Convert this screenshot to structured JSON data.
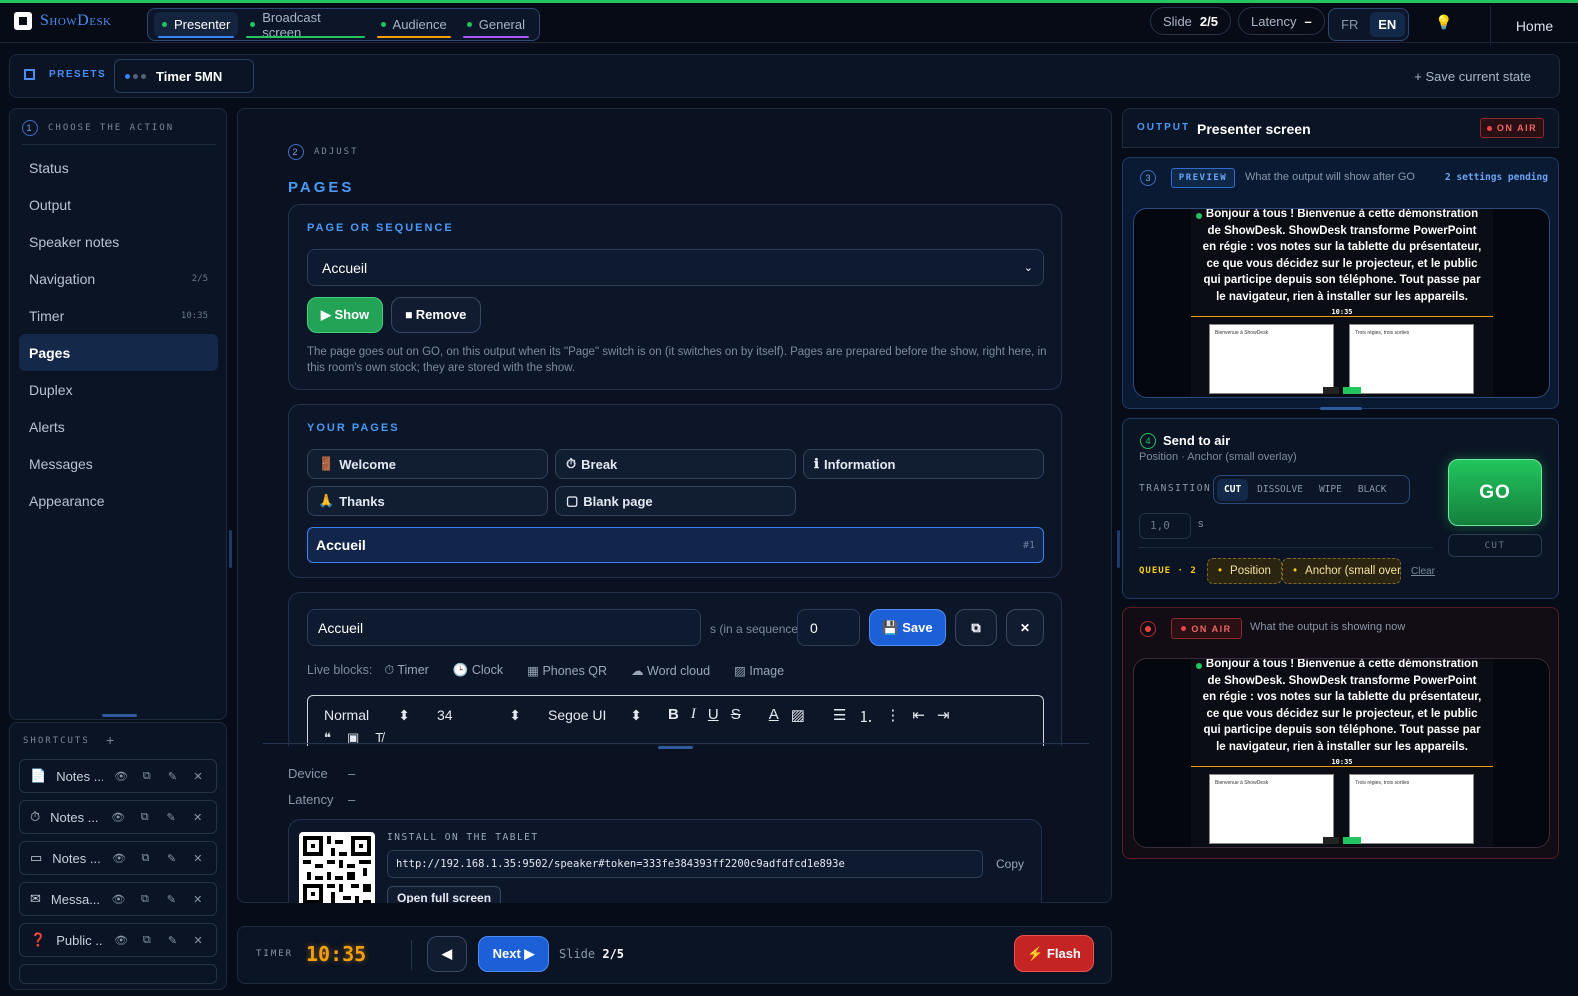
{
  "app": {
    "brand": "ShowDesk"
  },
  "tabs": [
    {
      "label": "Presenter",
      "color": "#3b82f6"
    },
    {
      "label": "Broadcast screen",
      "color": "#22c55e"
    },
    {
      "label": "Audience",
      "color": "#f59e0b"
    },
    {
      "label": "General",
      "color": "#a855f7"
    }
  ],
  "status": {
    "slide_label": "Slide",
    "slide_value": "2/5",
    "latency_label": "Latency",
    "latency_value": "–"
  },
  "languages": [
    "FR",
    "EN"
  ],
  "home": "Home",
  "presets": {
    "label": "PRESETS",
    "chip": "Timer 5MN",
    "save": "+ Save current state"
  },
  "step1": {
    "num": "1",
    "title": "CHOOSE THE ACTION"
  },
  "menu": [
    {
      "label": "Status",
      "badge": ""
    },
    {
      "label": "Output",
      "badge": ""
    },
    {
      "label": "Speaker notes",
      "badge": ""
    },
    {
      "label": "Navigation",
      "badge": "2/5"
    },
    {
      "label": "Timer",
      "badge": "10:35"
    },
    {
      "label": "Pages",
      "badge": ""
    },
    {
      "label": "Duplex",
      "badge": ""
    },
    {
      "label": "Alerts",
      "badge": ""
    },
    {
      "label": "Messages",
      "badge": ""
    },
    {
      "label": "Appearance",
      "badge": ""
    }
  ],
  "shortcuts": {
    "title": "SHORTCUTS",
    "add": "+",
    "items": [
      {
        "icon": "📄",
        "name": "Notes ..."
      },
      {
        "icon": "⏱",
        "name": "Notes ..."
      },
      {
        "icon": "▭",
        "name": "Notes ..."
      },
      {
        "icon": "✉",
        "name": "Messa..."
      },
      {
        "icon": "❓",
        "name": "Public ..."
      }
    ]
  },
  "step2": {
    "num": "2",
    "title": "ADJUST",
    "heading": "PAGES"
  },
  "page_seq": {
    "title": "PAGE OR SEQUENCE",
    "selected": "Accueil",
    "show": "▶ Show",
    "remove": "⏹ Remove",
    "help": "The page goes out on GO, on this output when its \"Page\" switch is on (it switches on by itself). Pages are prepared before the show, right here, in this room's own stock; they are stored with the show."
  },
  "your_pages": {
    "title": "YOUR PAGES",
    "items": [
      {
        "icon": "🚪",
        "label": "Welcome"
      },
      {
        "icon": "⏱",
        "label": "Break"
      },
      {
        "icon": "ℹ",
        "label": "Information"
      },
      {
        "icon": "🙏",
        "label": "Thanks"
      },
      {
        "icon": "▢",
        "label": "Blank page"
      }
    ],
    "active": {
      "label": "Accueil",
      "num": "#1"
    }
  },
  "editor": {
    "name": "Accueil",
    "seq_label": "s (in a sequence)",
    "seq_value": "0",
    "save": "💾 Save",
    "live_label": "Live blocks:",
    "live_blocks": [
      {
        "icon": "⏱",
        "label": "Timer"
      },
      {
        "icon": "🕒",
        "label": "Clock"
      },
      {
        "icon": "▦",
        "label": "Phones QR"
      },
      {
        "icon": "☁",
        "label": "Word cloud"
      },
      {
        "icon": "▨",
        "label": "Image"
      }
    ],
    "toolbar": {
      "style": "Normal",
      "size": "34",
      "font": "Segoe UI"
    }
  },
  "device": {
    "device_label": "Device",
    "device_value": "–",
    "latency_label": "Latency",
    "latency_value": "–"
  },
  "install": {
    "title": "INSTALL ON THE TABLET",
    "url": "http://192.168.1.35:9502/speaker#token=333fe384393ff2200c9adfdfcd1e893e",
    "copy": "Copy",
    "open": "Open full screen"
  },
  "bottom": {
    "timer_label": "TIMER",
    "timer_value": "10:35",
    "next": "Next ▶",
    "slide_label": "Slide",
    "slide_value": "2/5",
    "flash": "⚡ Flash"
  },
  "output": {
    "label": "OUTPUT",
    "name": "Presenter screen",
    "badge": "ON AIR"
  },
  "preview": {
    "num": "3",
    "badge": "PREVIEW",
    "desc": "What the output will show after GO",
    "pending": "2 settings pending",
    "text": "Bonjour à tous ! Bienvenue à cette démonstration de ShowDesk. ShowDesk transforme PowerPoint en régie : vos notes sur la tablette du présentateur, ce que vous décidez sur le projecteur, et le public qui participe depuis son téléphone. Tout passe par le navigateur, rien à installer sur les appareils.",
    "timer": "10:35",
    "mini_left_title": "Bienvenue à ShowDesk",
    "mini_right_title": "Trois régies, trois sorties"
  },
  "send": {
    "num": "4",
    "title": "Send to air",
    "subtitle": "Position · Anchor (small overlay)",
    "transition_label": "TRANSITION",
    "transitions": [
      "CUT",
      "DISSOLVE",
      "WIPE",
      "BLACK"
    ],
    "duration": "1,0",
    "unit": "s",
    "go": "GO",
    "cut": "CUT",
    "queue_label": "QUEUE · 2",
    "queue": [
      "Position",
      "Anchor (small overlay)"
    ],
    "clear": "Clear"
  },
  "onair": {
    "badge": "ON AIR",
    "desc": "What the output is showing now"
  }
}
